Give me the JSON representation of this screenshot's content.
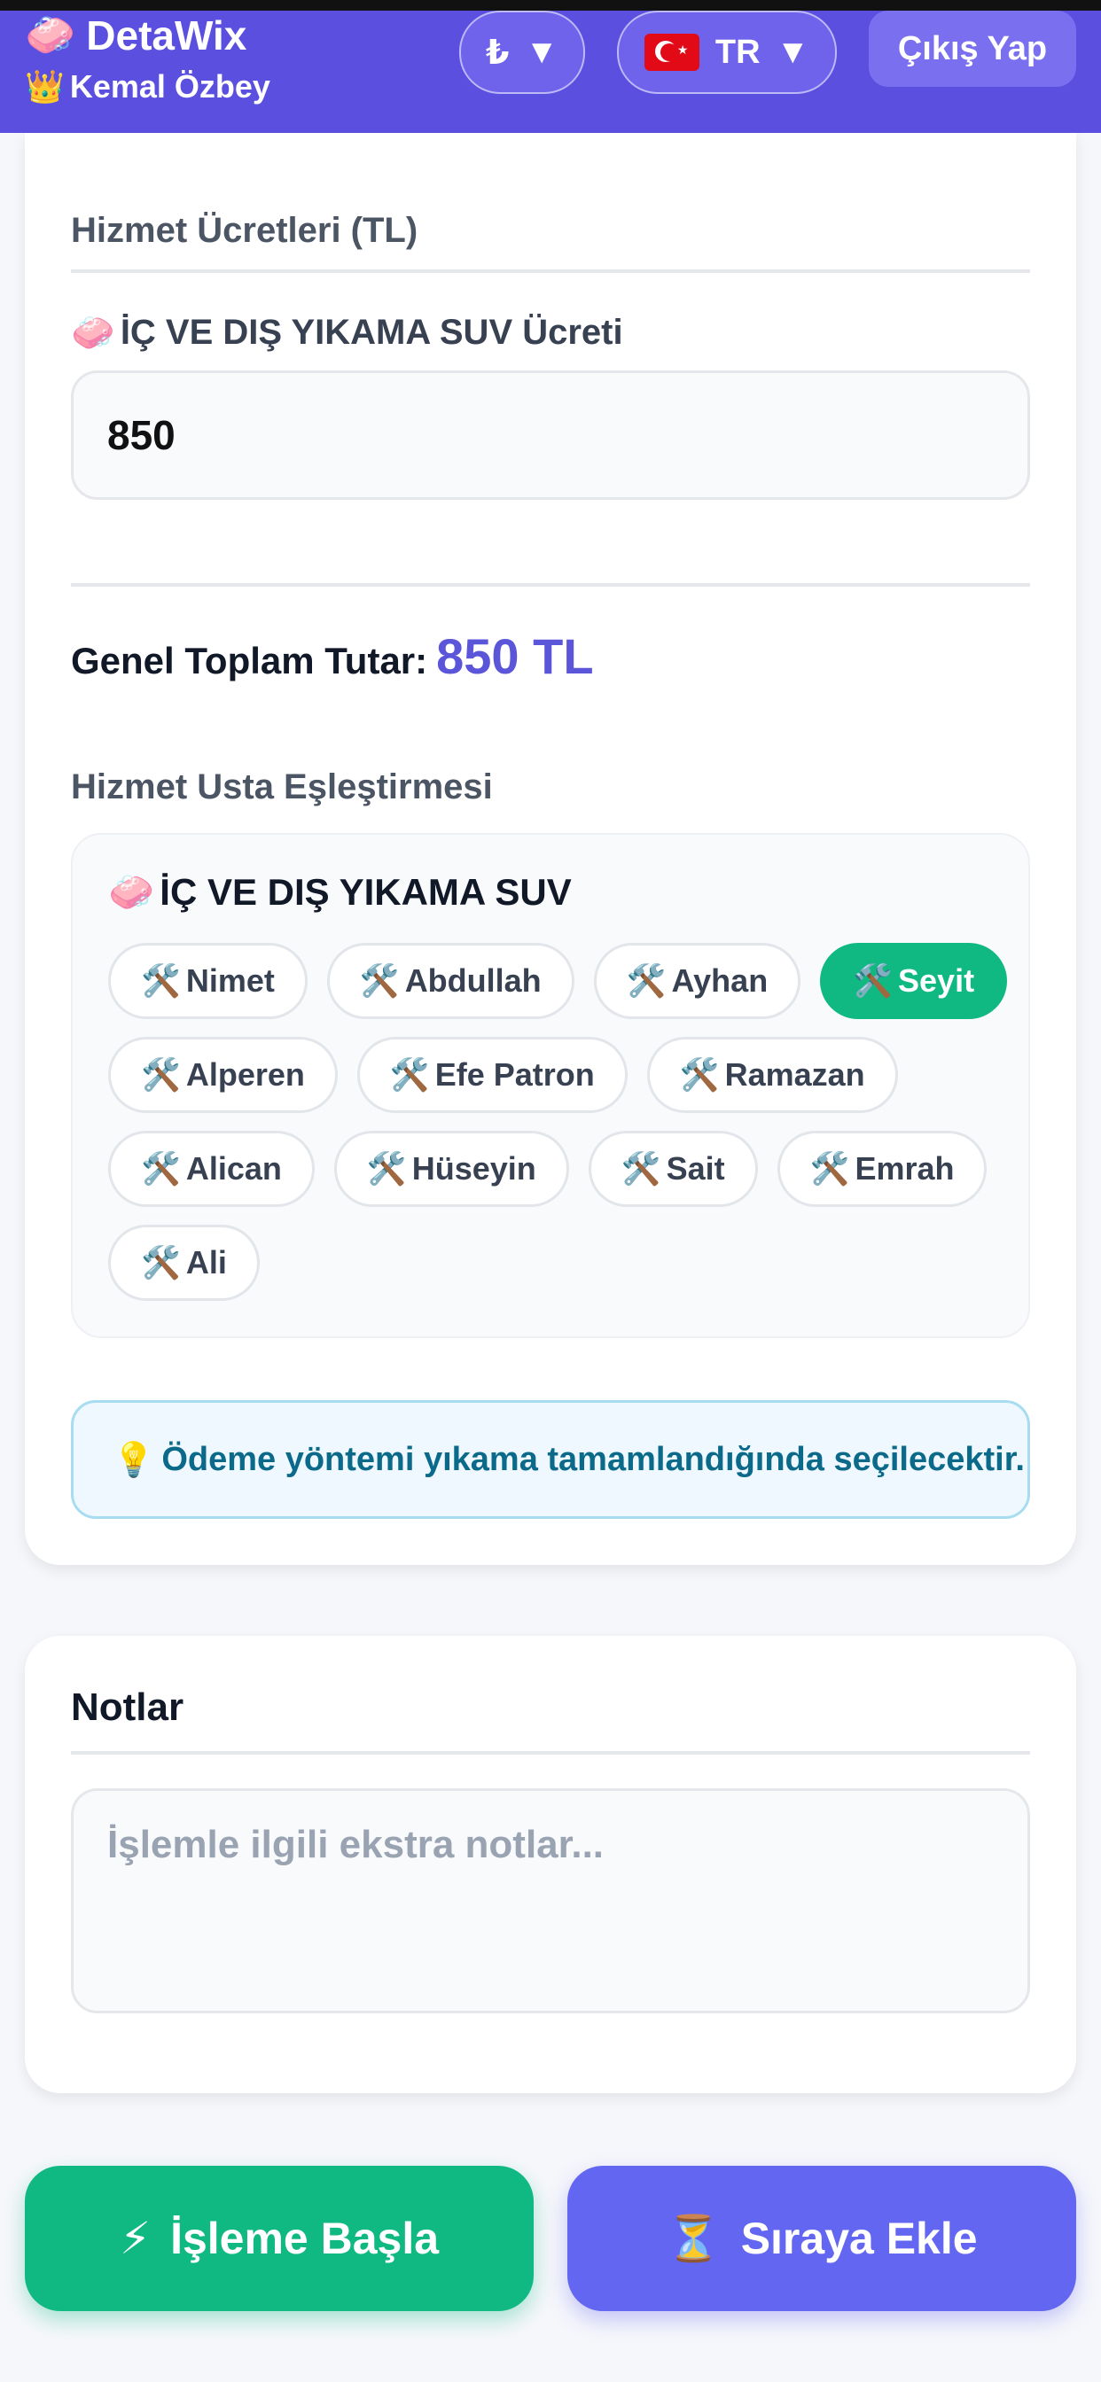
{
  "header": {
    "brand": "DetaWix",
    "brand_icon": "soap-emoji",
    "user_name": "Kemal Özbey",
    "user_icon": "crown-emoji",
    "currency_symbol": "₺",
    "language": "TR",
    "logout_label": "Çıkış Yap",
    "color": "#5b4fe0"
  },
  "services": {
    "section_title": "Hizmet Ücretleri (TL)",
    "price_label": "İÇ VE DIŞ YIKAMA SUV Ücreti",
    "price_value": "850",
    "total_label": "Genel Toplam Tutar:",
    "total_value": "850 TL"
  },
  "matching": {
    "section_title": "Hizmet Usta Eşleştirmesi",
    "service_name": "İÇ VE DIŞ YIKAMA SUV",
    "masters": [
      "Nimet",
      "Abdullah",
      "Ayhan",
      "Seyit",
      "Alperen",
      "Efe Patron",
      "Ramazan",
      "Alican",
      "Hüseyin",
      "Sait",
      "Emrah",
      "Ali"
    ],
    "selected": "Seyit"
  },
  "info": {
    "text": "Ödeme yöntemi yıkama tamamlandığında seçilecektir."
  },
  "notes": {
    "title": "Notlar",
    "placeholder": "İşlemle ilgili ekstra notlar..."
  },
  "actions": {
    "start_label": "İşleme Başla",
    "queue_label": "Sıraya Ekle",
    "start_color": "#10b981",
    "queue_color": "#6366f1"
  }
}
